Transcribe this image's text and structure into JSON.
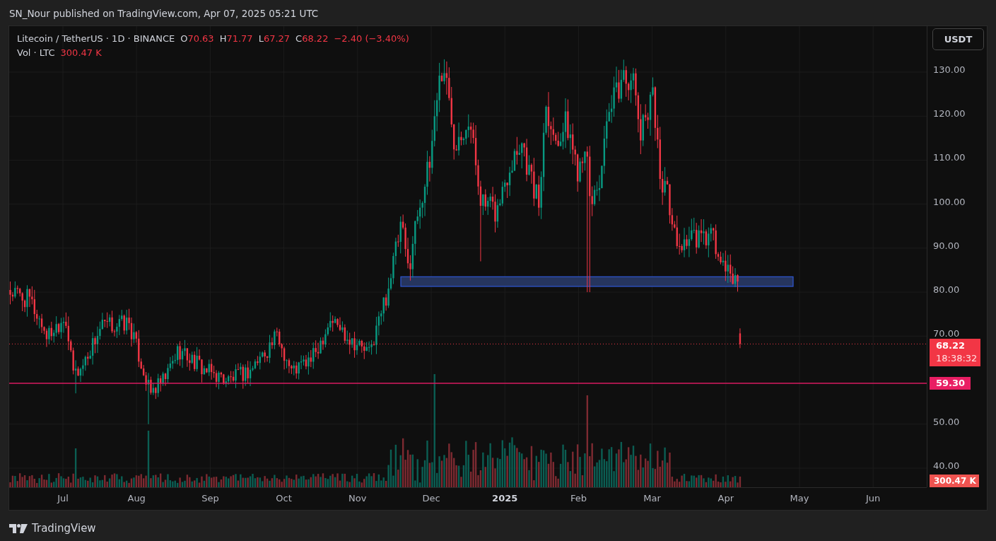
{
  "header": {
    "published": "SN_Nour published on TradingView.com, Apr 07, 2025 05:21 UTC"
  },
  "legend": {
    "symbol": "Litecoin / TetherUS · 1D · BINANCE",
    "ohlc": [
      {
        "key": "O",
        "value": "70.63"
      },
      {
        "key": "H",
        "value": "71.77"
      },
      {
        "key": "L",
        "value": "67.27"
      },
      {
        "key": "C",
        "value": "68.22"
      }
    ],
    "change": "−2.40 (−3.40%)",
    "volume_label": "Vol · LTC",
    "volume_value": "300.47 K"
  },
  "currency_button": "USDT",
  "price_axis": {
    "ticks": [
      "130.00",
      "120.00",
      "110.00",
      "100.00",
      "90.00",
      "80.00",
      "70.00",
      "50.00",
      "40.00"
    ]
  },
  "price_labels": {
    "last_price": "68.22",
    "countdown": "18:38:32",
    "level_line": "59.30",
    "volume": "300.47 K"
  },
  "time_axis": {
    "labels": [
      {
        "text": "Jul",
        "kind": "month"
      },
      {
        "text": "Aug",
        "kind": "month"
      },
      {
        "text": "Sep",
        "kind": "month"
      },
      {
        "text": "Oct",
        "kind": "month"
      },
      {
        "text": "Nov",
        "kind": "month"
      },
      {
        "text": "Dec",
        "kind": "month"
      },
      {
        "text": "2025",
        "kind": "year"
      },
      {
        "text": "Feb",
        "kind": "month"
      },
      {
        "text": "Mar",
        "kind": "month"
      },
      {
        "text": "Apr",
        "kind": "month"
      },
      {
        "text": "May",
        "kind": "month"
      },
      {
        "text": "Jun",
        "kind": "month"
      }
    ]
  },
  "footer": {
    "brand": "TradingView"
  }
}
